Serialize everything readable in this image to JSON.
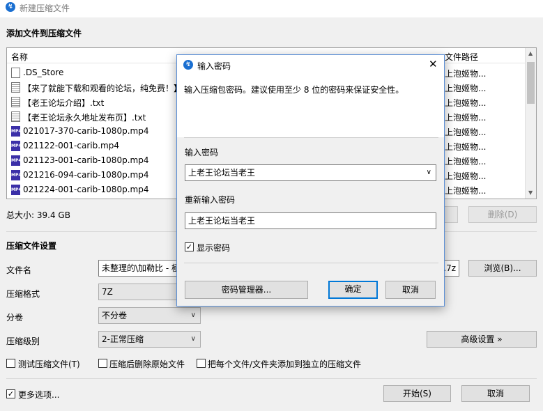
{
  "window": {
    "title": "新建压缩文件"
  },
  "add_files": {
    "heading": "添加文件到压缩文件",
    "columns": {
      "name": "名称",
      "path": "文件路径"
    },
    "files": [
      {
        "name": ".DS_Store",
        "icon": "document-icon",
        "path": "上泡姬物..."
      },
      {
        "name": "【来了就能下载和观看的论坛，纯免费！】",
        "icon": "text-file-icon",
        "path": "上泡姬物..."
      },
      {
        "name": "【老王论坛介绍】.txt",
        "icon": "text-file-icon",
        "path": "上泡姬物..."
      },
      {
        "name": "【老王论坛永久地址发布页】.txt",
        "icon": "text-file-icon",
        "path": "上泡姬物..."
      },
      {
        "name": "021017-370-carib-1080p.mp4",
        "icon": "mp4-file-icon",
        "path": "上泡姬物..."
      },
      {
        "name": "021122-001-carib.mp4",
        "icon": "mp4-file-icon",
        "path": "上泡姬物..."
      },
      {
        "name": "021123-001-carib-1080p.mp4",
        "icon": "mp4-file-icon",
        "path": "上泡姬物..."
      },
      {
        "name": "021216-094-carib-1080p.mp4",
        "icon": "mp4-file-icon",
        "path": "上泡姬物..."
      },
      {
        "name": "021224-001-carib-1080p.mp4",
        "icon": "mp4-file-icon",
        "path": "上泡姬物..."
      }
    ],
    "total_size": "总大小: 39.4 GB",
    "delete_label": "删除(D)"
  },
  "settings": {
    "heading": "压缩文件设置",
    "filename_label": "文件名",
    "filename_value": "未整理的\\加勒比 - 極",
    "filename_ext": ".7z",
    "browse_label": "浏览(B)...",
    "format_label": "压缩格式",
    "format_value": "7Z",
    "split_label": "分卷",
    "split_value": "不分卷",
    "level_label": "压缩级别",
    "level_value": "2-正常压缩",
    "advanced_label": "高级设置 »",
    "test_label": "测试压缩文件(T)",
    "delete_after_label": "压缩后删除原始文件",
    "separate_label": "把每个文件/文件夹添加到独立的压缩文件",
    "more_options_label": "更多选项...",
    "start_label": "开始(S)",
    "cancel_label": "取消"
  },
  "password_dialog": {
    "title": "输入密码",
    "hint": "输入压缩包密码。建议使用至少 8 位的密码来保证安全性。",
    "enter_label": "输入密码",
    "enter_value": "上老王论坛当老王",
    "reenter_label": "重新输入密码",
    "reenter_value": "上老王论坛当老王",
    "show_password_label": "显示密码",
    "manager_label": "密码管理器...",
    "ok_label": "确定",
    "cancel_label": "取消"
  },
  "colors": {
    "accent": "#0078d7",
    "app_icon": "#1a6fd1"
  }
}
